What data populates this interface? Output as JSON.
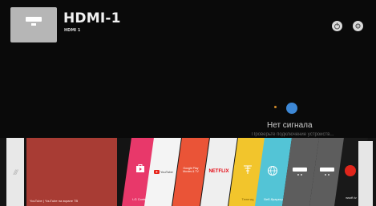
{
  "header": {
    "title": "HDMI-1",
    "subtitle": "HDMI 1",
    "input_icon": "hdmi-icon",
    "buttons": [
      {
        "name": "power-button",
        "icon": "power-icon"
      },
      {
        "name": "settings-button",
        "icon": "gear-icon"
      }
    ]
  },
  "no_signal": {
    "title": "Нет сигнала",
    "message": "Проверьте подключение устройств..."
  },
  "launcher": {
    "recent_label": "YouTube | YouTube на экране ТВ",
    "apps": [
      {
        "key": "lgcontent",
        "label": "LG Conten"
      },
      {
        "key": "youtube",
        "label": "YouTube"
      },
      {
        "key": "stores",
        "label": "Google Play Movies & TV"
      },
      {
        "key": "netflix",
        "label": "NETFLIX"
      },
      {
        "key": "channels",
        "label": "Телегид"
      },
      {
        "key": "globe",
        "label": "Веб-браузер"
      },
      {
        "key": "hdmi2",
        "label": ""
      },
      {
        "key": "hdmi3",
        "label": ""
      },
      {
        "key": "wsoft",
        "label": "wsoft.tv"
      }
    ]
  },
  "colors": {
    "youtube": "#e62117",
    "netflix": "#e50914",
    "accent": "#3d88d6"
  }
}
